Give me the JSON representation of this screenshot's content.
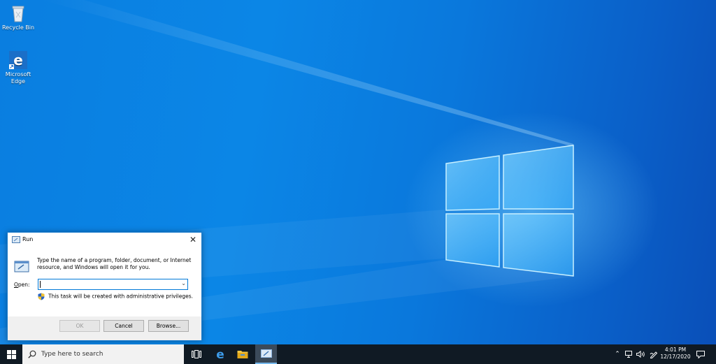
{
  "desktop": {
    "icons": [
      {
        "label": "Recycle Bin",
        "icon": "recycle-bin-icon"
      },
      {
        "label": "Microsoft Edge",
        "icon": "edge-icon"
      }
    ]
  },
  "run_dialog": {
    "title": "Run",
    "description": "Type the name of a program, folder, document, or Internet resource, and Windows will open it for you.",
    "open_label_accel": "O",
    "open_label_rest": "pen:",
    "open_value": "",
    "admin_note": "This task will be created with administrative privileges.",
    "ok_label": "OK",
    "cancel_label": "Cancel",
    "browse_label": "Browse..."
  },
  "taskbar": {
    "search_placeholder": "Type here to search",
    "time": "4:01 PM",
    "date": "12/17/2020"
  },
  "colors": {
    "accent": "#0078d7",
    "taskbar_bg": "#101a24"
  }
}
